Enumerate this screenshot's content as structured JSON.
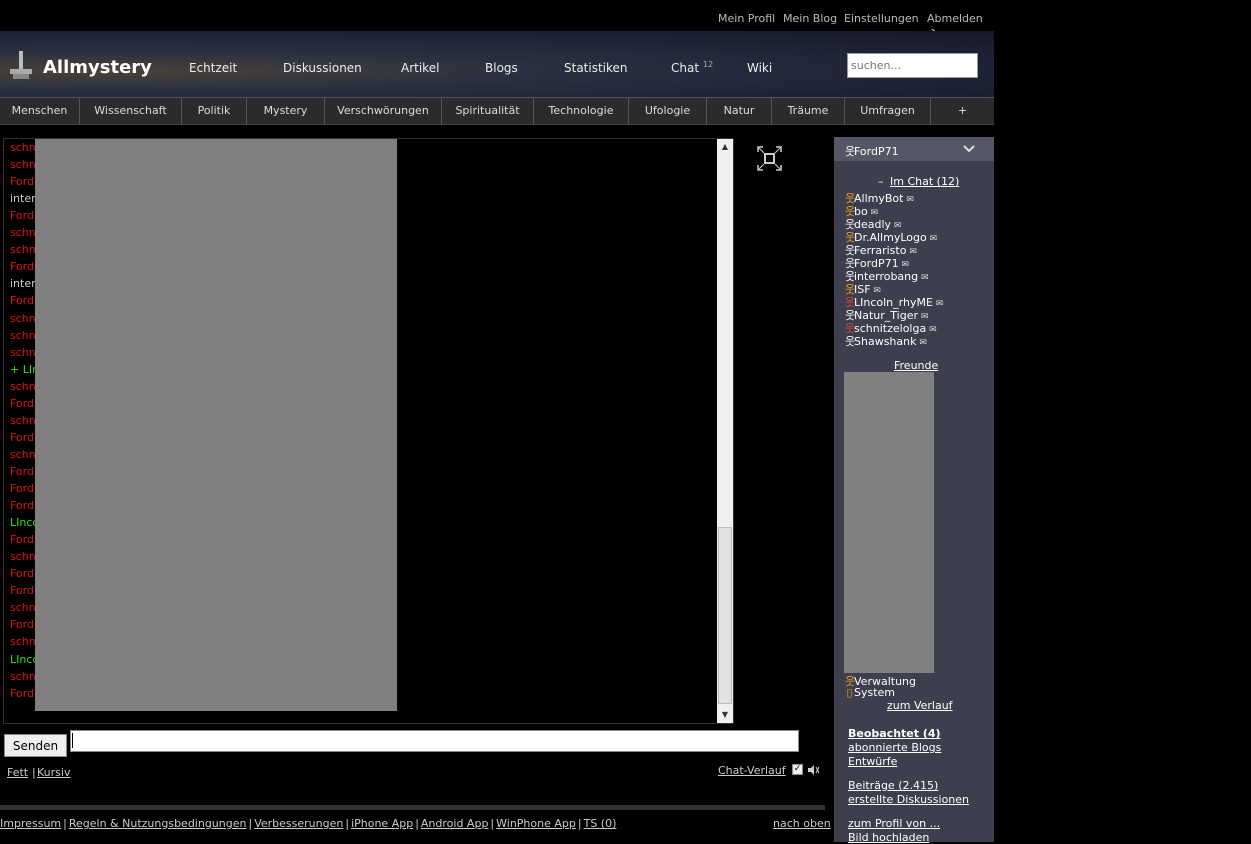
{
  "userbar": {
    "links": [
      "Mein Profil",
      "Mein Blog",
      "Einstellungen",
      "Abmelden ➔"
    ]
  },
  "header": {
    "logo": "Allmystery",
    "nav": [
      "Echtzeit",
      "Diskussionen",
      "Artikel",
      "Blogs",
      "Statistiken",
      "Chat",
      "Wiki"
    ],
    "chat_count": "12",
    "search_placeholder": "suchen..."
  },
  "categories": [
    "Menschen",
    "Wissenschaft",
    "Politik",
    "Mystery",
    "Verschwörungen",
    "Spiritualität",
    "Technologie",
    "Ufologie",
    "Natur",
    "Träume",
    "Umfragen",
    "+"
  ],
  "chat": {
    "lines": [
      {
        "text": "schn",
        "color": "red"
      },
      {
        "text": "schn",
        "color": "red"
      },
      {
        "text": "Ford",
        "color": "red"
      },
      {
        "text": "inter",
        "color": "grey"
      },
      {
        "text": "Ford",
        "color": "red"
      },
      {
        "text": "schn",
        "color": "red"
      },
      {
        "text": "schn",
        "color": "red"
      },
      {
        "text": "Ford",
        "color": "red"
      },
      {
        "text": "inter",
        "color": "grey"
      },
      {
        "text": "Ford",
        "color": "red"
      },
      {
        "text": "schn",
        "color": "red"
      },
      {
        "text": "schn",
        "color": "red"
      },
      {
        "text": "schn",
        "color": "red"
      },
      {
        "text": "+ LInc",
        "color": "green"
      },
      {
        "text": "schn",
        "color": "red"
      },
      {
        "text": "Ford",
        "color": "red"
      },
      {
        "text": "schn",
        "color": "red"
      },
      {
        "text": "Ford",
        "color": "red"
      },
      {
        "text": "schn",
        "color": "red"
      },
      {
        "text": "Ford",
        "color": "red"
      },
      {
        "text": "Ford",
        "color": "red"
      },
      {
        "text": "Ford",
        "color": "red"
      },
      {
        "text": "LInco",
        "color": "green"
      },
      {
        "text": "Ford",
        "color": "red"
      },
      {
        "text": "schn",
        "color": "red"
      },
      {
        "text": "Ford",
        "color": "red"
      },
      {
        "text": "Ford",
        "color": "red"
      },
      {
        "text": "schn",
        "color": "red"
      },
      {
        "text": "Ford",
        "color": "red"
      },
      {
        "text": "schn",
        "color": "red"
      },
      {
        "text": "LInco",
        "color": "green"
      },
      {
        "text": "schn",
        "color": "red"
      },
      {
        "text": "Ford",
        "color": "red"
      }
    ],
    "send_label": "Senden",
    "format_bold": "Fett",
    "format_italic": "Kursiv",
    "history_link": "Chat-Verlauf"
  },
  "footer": {
    "links": [
      "Impressum",
      "Regeln & Nutzungsbedingungen",
      "Verbesserungen",
      "iPhone App",
      "Android App",
      "WinPhone App",
      "TS (0)"
    ],
    "top_link": "nach oben"
  },
  "sidebar": {
    "username": "FordP71",
    "in_chat_label": "Im Chat (12)",
    "users": [
      {
        "name": "AllmyBot",
        "color": "orange"
      },
      {
        "name": "bo",
        "color": "orange"
      },
      {
        "name": "deadly",
        "color": "white"
      },
      {
        "name": "Dr.AllmyLogo",
        "color": "orange"
      },
      {
        "name": "Ferraristo",
        "color": "white"
      },
      {
        "name": "FordP71",
        "color": "white"
      },
      {
        "name": "interrobang",
        "color": "white"
      },
      {
        "name": "ISF",
        "color": "orange"
      },
      {
        "name": "LIncoln_rhyME",
        "color": "red"
      },
      {
        "name": "Natur_Tiger",
        "color": "white"
      },
      {
        "name": "schnitzelolga",
        "color": "red"
      },
      {
        "name": "Shawshank",
        "color": "white"
      }
    ],
    "friends_label": "Freunde",
    "legend_admin": "Verwaltung",
    "legend_system": "System",
    "history_link": "zum Verlauf",
    "watched": "Beobachtet (4)",
    "subscribed_blogs": "abonnierte Blogs",
    "drafts": "Entwürfe",
    "posts": "Beiträge (2.415)",
    "created_discussions": "erstellte Diskussionen",
    "profile_link": "zum Profil von ...",
    "upload_image": "Bild hochladen"
  }
}
